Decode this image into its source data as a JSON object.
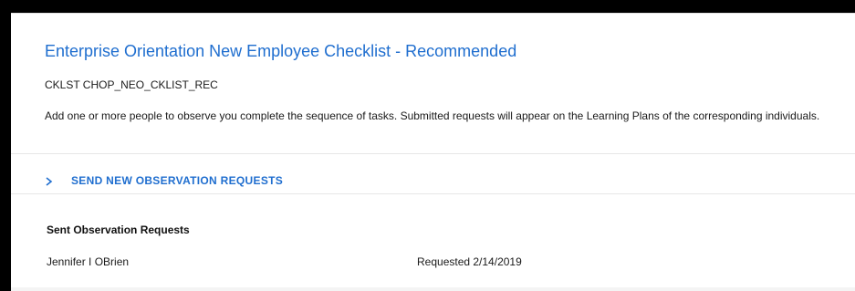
{
  "checklist": {
    "title": "Enterprise Orientation New Employee Checklist - Recommended",
    "code": "CKLST CHOP_NEO_CKLIST_REC",
    "description": "Add one or more people to observe you complete the sequence of tasks. Submitted requests will appear on the Learning Plans of the corresponding individuals."
  },
  "send_section": {
    "label": "SEND NEW OBSERVATION REQUESTS",
    "icon": "chevron-right-icon",
    "expanded": false
  },
  "sent_section": {
    "heading": "Sent Observation Requests",
    "requests": [
      {
        "name": "Jennifer I OBrien",
        "status": "Requested 2/14/2019"
      }
    ]
  },
  "colors": {
    "accent": "#1f6ecf",
    "frame": "#000000",
    "text": "#1a1a1a",
    "divider": "#e6e6e6"
  }
}
